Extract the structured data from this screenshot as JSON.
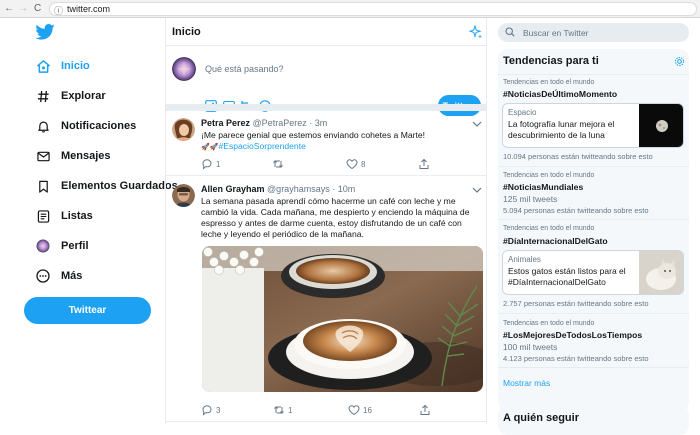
{
  "browser": {
    "back_glyph": "←",
    "forward_glyph": "→",
    "reload_glyph": "C",
    "info_glyph": "ⓘ",
    "url": "twitter.com"
  },
  "sidebar": {
    "items": [
      {
        "label": "Inicio",
        "icon": "home-icon",
        "active": true
      },
      {
        "label": "Explorar",
        "icon": "hashtag-icon"
      },
      {
        "label": "Notificaciones",
        "icon": "bell-icon"
      },
      {
        "label": "Mensajes",
        "icon": "envelope-icon"
      },
      {
        "label": "Elementos Guardados",
        "icon": "bookmark-icon"
      },
      {
        "label": "Listas",
        "icon": "list-icon"
      },
      {
        "label": "Perfil",
        "icon": "profile-avatar-icon"
      },
      {
        "label": "Más",
        "icon": "more-dots-icon"
      }
    ],
    "tweet_button": "Twittear"
  },
  "main": {
    "title": "Inicio",
    "compose": {
      "placeholder": "Qué está pasando?",
      "button": "Twittear"
    },
    "tweets": [
      {
        "name": "Petra Perez",
        "handle": "@PetraPerez",
        "time": "· 3m",
        "text": "¡Me parece genial que estemos enviando cohetes a Marte!",
        "emoji": "🚀🚀",
        "hashtag": "#EspacioSorprendente",
        "replies": "1",
        "retweets": "",
        "likes": "8"
      },
      {
        "name": "Allen Grayham",
        "handle": "@grayhamsays",
        "time": "· 10m",
        "text": "La semana pasada aprendí cómo hacerme un café con leche y me cambió la vida. Cada mañana, me despierto y enciendo la máquina de espresso y antes de darme cuenta, estoy disfrutando de un café con leche y leyendo el periódico de la mañana.",
        "replies": "3",
        "retweets": "1",
        "likes": "16"
      }
    ]
  },
  "right": {
    "search_placeholder": "Buscar en Twitter",
    "trends_title": "Tendencias para ti",
    "trends": [
      {
        "context": "Tendencias en todo el mundo",
        "tag": "#NoticiasDeÚltimoMomento",
        "card_label": "Espacio",
        "card_text": "La fotografía lunar mejora el descubrimiento de la luna",
        "count": "10.094 personas están twitteando sobre esto"
      },
      {
        "context": "Tendencias en todo el mundo",
        "tag": "#NoticiasMundiales",
        "sub": "125 mil tweets",
        "count": "5.094 personas están twitteando sobre esto"
      },
      {
        "context": "Tendencias en todo el mundo",
        "tag": "#DíaInternacionalDelGato",
        "card_label": "Animales",
        "card_text": "Estos gatos están listos para el #DíaInternacionalDelGato",
        "count": "2.757 personas están twitteando sobre esto"
      },
      {
        "context": "Tendencias en todo el mundo",
        "tag": "#LosMejoresDeTodosLosTiempos",
        "sub": "100 mil tweets",
        "count": "4.123 personas están twitteando sobre esto"
      }
    ],
    "show_more": "Mostrar más",
    "who_to_follow": "A quién seguir"
  },
  "colors": {
    "accent": "#1da1f2",
    "secondary_text": "#657786",
    "border": "#e6ecf0",
    "panel_bg": "#f5f8fa"
  }
}
